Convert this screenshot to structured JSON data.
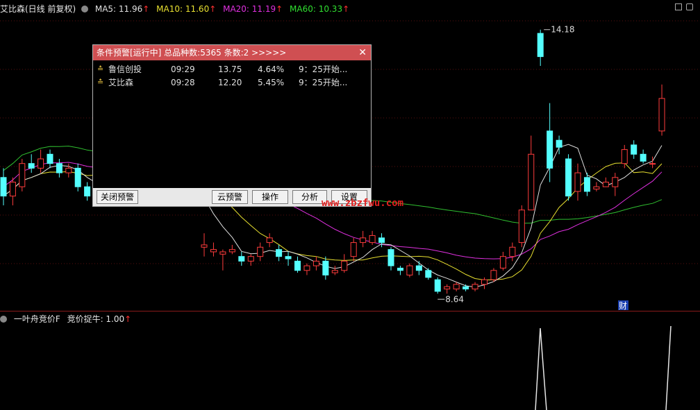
{
  "header": {
    "stock_title": "艾比森(日线 前复权)",
    "ma": [
      {
        "label": "MA5: 11.96",
        "color": "#e0e0e0"
      },
      {
        "label": "MA10: 11.60",
        "color": "#e8e030"
      },
      {
        "label": "MA20: 11.19",
        "color": "#e030e0"
      },
      {
        "label": "MA60: 10.33",
        "color": "#30e030"
      }
    ],
    "up_arrow": "↑"
  },
  "chart_data": {
    "type": "candlestick",
    "high_label": "14.18",
    "low_label": "8.64",
    "fin_marker": "财",
    "colors": {
      "up": "#ff3c3c",
      "down": "#54ffff",
      "ma5": "#e0e0e0",
      "ma10": "#e8e030",
      "ma20": "#e030e0",
      "ma60": "#30c030"
    },
    "price_range": [
      8.4,
      14.4
    ],
    "candles": [
      [
        11.0,
        10.6,
        11.2,
        10.4
      ],
      [
        10.6,
        10.9,
        11.0,
        10.4
      ],
      [
        10.8,
        11.3,
        11.4,
        10.7
      ],
      [
        11.3,
        11.2,
        11.5,
        11.1
      ],
      [
        11.2,
        11.4,
        11.6,
        11.1
      ],
      [
        11.5,
        11.3,
        11.6,
        11.2
      ],
      [
        11.3,
        11.1,
        11.4,
        11.0
      ],
      [
        11.1,
        11.2,
        11.3,
        11.0
      ],
      [
        11.2,
        10.8,
        11.3,
        10.7
      ],
      [
        10.8,
        10.6,
        10.9,
        10.5
      ],
      [
        10.6,
        10.7,
        10.8,
        10.5
      ],
      [
        9.5,
        9.55,
        9.8,
        9.3
      ],
      [
        9.4,
        9.45,
        9.6,
        9.3
      ],
      [
        9.35,
        9.4,
        9.45,
        9.0
      ],
      [
        9.4,
        9.45,
        9.55,
        9.35
      ],
      [
        9.3,
        9.2,
        9.4,
        9.1
      ],
      [
        9.2,
        9.3,
        9.35,
        9.1
      ],
      [
        9.3,
        9.5,
        9.6,
        9.2
      ],
      [
        9.6,
        9.7,
        9.8,
        9.5
      ],
      [
        9.45,
        9.3,
        9.55,
        9.2
      ],
      [
        9.3,
        9.25,
        9.4,
        9.1
      ],
      [
        9.2,
        9.0,
        9.3,
        8.95
      ],
      [
        9.0,
        9.1,
        9.15,
        8.9
      ],
      [
        9.1,
        9.2,
        9.3,
        9.0
      ],
      [
        9.2,
        8.9,
        9.3,
        8.8
      ],
      [
        8.95,
        9.0,
        9.1,
        8.9
      ],
      [
        9.0,
        9.2,
        9.35,
        8.95
      ],
      [
        9.3,
        9.6,
        9.7,
        9.2
      ],
      [
        9.6,
        9.7,
        9.85,
        9.5
      ],
      [
        9.6,
        9.75,
        9.85,
        9.55
      ],
      [
        9.7,
        9.6,
        9.8,
        9.5
      ],
      [
        9.45,
        9.1,
        9.5,
        9.0
      ],
      [
        9.05,
        9.0,
        9.1,
        8.9
      ],
      [
        8.9,
        9.1,
        9.15,
        8.85
      ],
      [
        9.1,
        9.0,
        9.2,
        8.9
      ],
      [
        9.0,
        8.85,
        9.05,
        8.8
      ],
      [
        8.8,
        8.55,
        8.85,
        8.5
      ],
      [
        8.6,
        8.65,
        8.7,
        8.5
      ],
      [
        8.6,
        8.7,
        8.75,
        8.55
      ],
      [
        8.65,
        8.6,
        8.7,
        8.55
      ],
      [
        8.6,
        8.7,
        8.75,
        8.55
      ],
      [
        8.7,
        8.8,
        8.85,
        8.6
      ],
      [
        8.8,
        9.0,
        9.05,
        8.75
      ],
      [
        9.05,
        9.3,
        9.4,
        9.0
      ],
      [
        9.3,
        9.5,
        9.6,
        9.2
      ],
      [
        9.6,
        10.3,
        10.4,
        9.5
      ],
      [
        10.3,
        11.5,
        11.9,
        10.3
      ],
      [
        14.1,
        13.6,
        14.18,
        13.4
      ],
      [
        12.0,
        11.2,
        12.6,
        10.9
      ],
      [
        11.8,
        11.65,
        11.9,
        11.5
      ],
      [
        11.4,
        10.6,
        11.5,
        10.5
      ],
      [
        10.7,
        11.1,
        11.3,
        10.5
      ],
      [
        11.0,
        10.7,
        11.1,
        10.6
      ],
      [
        10.75,
        10.8,
        10.9,
        10.7
      ],
      [
        10.8,
        10.9,
        11.0,
        10.8
      ],
      [
        10.8,
        11.0,
        11.1,
        10.6
      ],
      [
        11.3,
        11.6,
        11.7,
        11.2
      ],
      [
        11.7,
        11.5,
        11.8,
        11.4
      ],
      [
        11.5,
        11.35,
        11.6,
        11.3
      ],
      [
        11.3,
        11.3,
        11.45,
        11.2
      ],
      [
        12.0,
        12.7,
        13.0,
        11.9
      ]
    ]
  },
  "dialog": {
    "title": "条件预警[运行中] 总品种数:5365 条数:2 >>>>>",
    "close": "✕",
    "rows": [
      {
        "mark": "≛",
        "name": "鲁信创投",
        "time": "09:29",
        "price": "13.75",
        "pct": "4.64%",
        "note": "9：25开始..."
      },
      {
        "mark": "≛",
        "name": "艾比森",
        "time": "09:28",
        "price": "12.20",
        "pct": "5.45%",
        "note": "9：25开始..."
      }
    ],
    "buttons": {
      "close_alert": "关闭预警",
      "cloud": "云预警",
      "operate": "操作",
      "analyze": "分析",
      "settings": "设置"
    }
  },
  "watermark": "www.zbzfwu.com",
  "indicator": {
    "title": "一叶舟竞价F",
    "value_label": "竞价捉牛: 1.00",
    "up_arrow": "↑"
  }
}
